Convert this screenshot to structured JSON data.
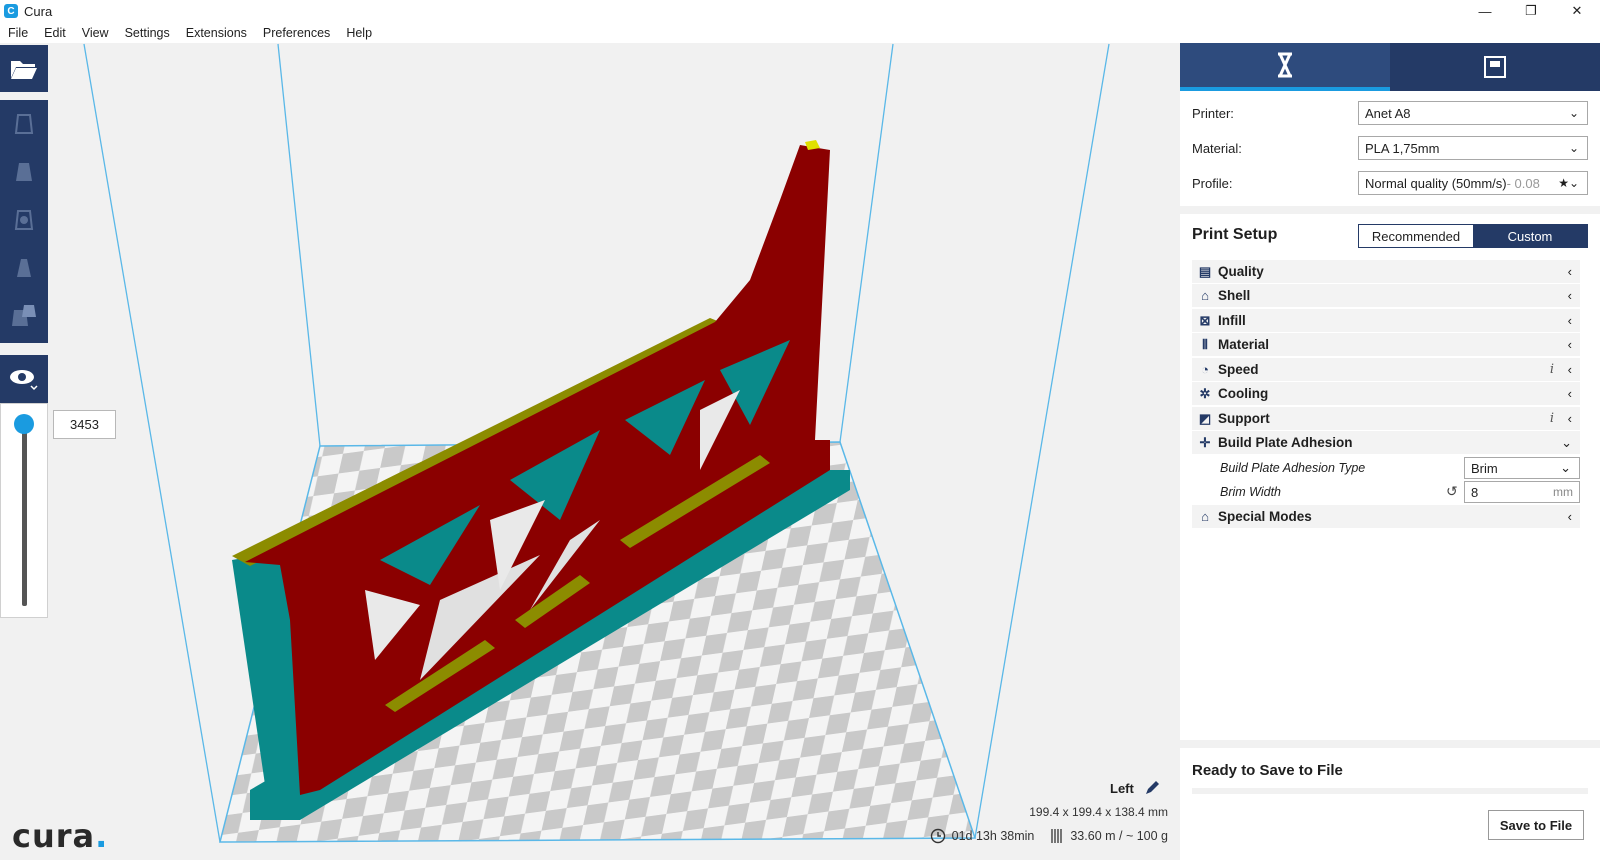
{
  "window": {
    "title": "Cura",
    "minimize": "—",
    "restore": "❐",
    "close": "✕"
  },
  "menu": [
    "File",
    "Edit",
    "View",
    "Settings",
    "Extensions",
    "Preferences",
    "Help"
  ],
  "layer_slider": {
    "value": "3453",
    "fraction": 1.0
  },
  "viewport": {
    "view_name": "Left",
    "dimensions": "199.4 x 199.4 x 138.4 mm",
    "print_time": "01d 13h 38min",
    "material_usage": "33.60 m / ~ 100 g",
    "logo_text": "cura",
    "logo_dot": "."
  },
  "machine": {
    "printer_label": "Printer:",
    "printer_value": "Anet A8",
    "material_label": "Material:",
    "material_value": "PLA 1,75mm",
    "profile_label": "Profile:",
    "profile_value": "Normal quality (50mm/s)",
    "profile_hint": " - 0.08"
  },
  "print_setup": {
    "title": "Print Setup",
    "recommended": "Recommended",
    "custom": "Custom",
    "categories": [
      {
        "label": "Quality",
        "icon": "quality-icon"
      },
      {
        "label": "Shell",
        "icon": "shell-icon"
      },
      {
        "label": "Infill",
        "icon": "infill-icon"
      },
      {
        "label": "Material",
        "icon": "material-icon"
      },
      {
        "label": "Speed",
        "icon": "speed-icon"
      },
      {
        "label": "Cooling",
        "icon": "cooling-icon"
      },
      {
        "label": "Support",
        "icon": "support-icon"
      },
      {
        "label": "Build Plate Adhesion",
        "icon": "adhesion-icon"
      },
      {
        "label": "Special Modes",
        "icon": "special-modes-icon"
      }
    ],
    "adhesion_type_label": "Build Plate Adhesion Type",
    "adhesion_type_value": "Brim",
    "brim_width_label": "Brim Width",
    "brim_width_value": "8",
    "brim_width_unit": "mm",
    "info_glyph": "i"
  },
  "output": {
    "status": "Ready to Save to File",
    "save_button": "Save to File"
  },
  "colors": {
    "accent": "#1a9be0",
    "dark_blue": "#243a66",
    "model_red": "#8b0000",
    "model_teal": "#0a8a8a",
    "model_olive": "#8c8c00"
  }
}
